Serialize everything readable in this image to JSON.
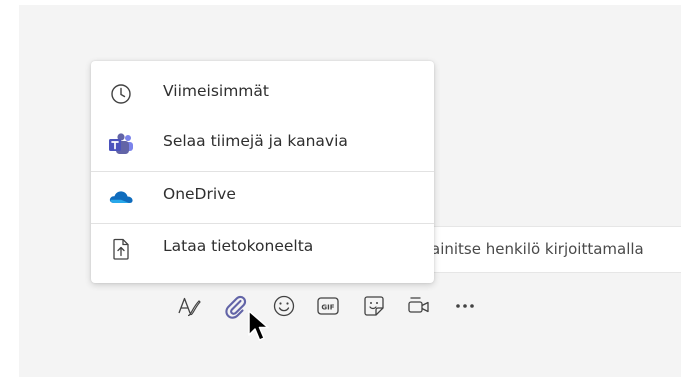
{
  "attach_menu": {
    "items": [
      {
        "label": "Viimeisimmät",
        "icon": "clock-icon"
      },
      {
        "label": "Selaa tiimejä ja kanavia",
        "icon": "teams-icon"
      },
      {
        "label": "OneDrive",
        "icon": "onedrive-cloud-icon"
      },
      {
        "label": "Lataa tietokoneelta",
        "icon": "upload-file-icon"
      }
    ]
  },
  "compose": {
    "placeholder": "ainitse henkilö kirjoittamalla"
  },
  "toolbar": {
    "icons": [
      "format-icon",
      "attach-icon",
      "emoji-icon",
      "gif-icon",
      "sticker-icon",
      "meet-now-icon",
      "more-options-icon"
    ]
  },
  "colors": {
    "teams_purple": "#6264a7",
    "onedrive_blue": "#0f6cbd",
    "icon_gray": "#424242"
  }
}
